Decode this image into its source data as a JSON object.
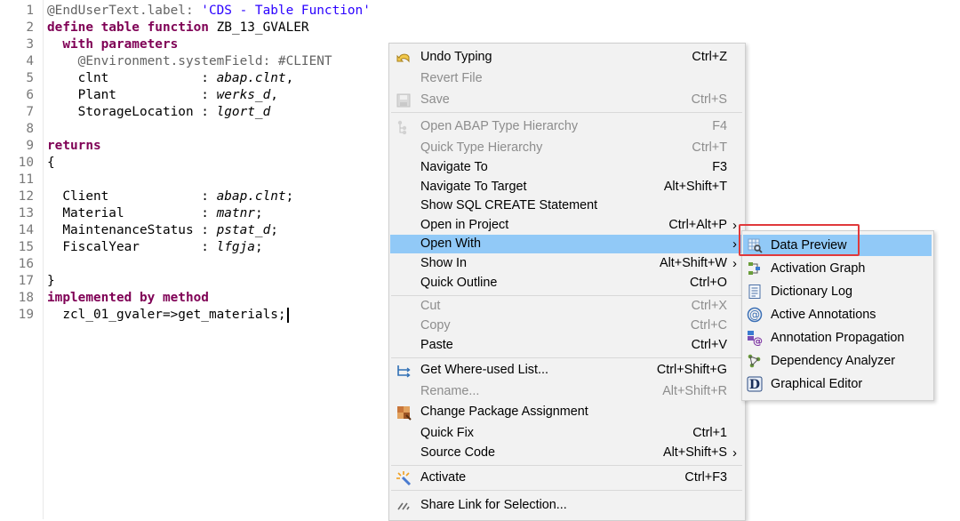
{
  "editor": {
    "lines": [
      {
        "n": "1",
        "parts": [
          {
            "t": "@EndUserText.label: ",
            "c": "ann"
          },
          {
            "t": "'CDS - Table Function'",
            "c": "str"
          }
        ]
      },
      {
        "n": "2",
        "parts": [
          {
            "t": "define table function",
            "c": "kw"
          },
          {
            "t": " ZB_13_GVALER",
            "c": "plain"
          }
        ]
      },
      {
        "n": "3",
        "parts": [
          {
            "t": "  with parameters",
            "c": "kw"
          }
        ]
      },
      {
        "n": "4",
        "parts": [
          {
            "t": "    @Environment.systemField: #CLIENT",
            "c": "ann"
          }
        ]
      },
      {
        "n": "5",
        "parts": [
          {
            "t": "    clnt            : ",
            "c": "plain"
          },
          {
            "t": "abap.clnt",
            "c": "typ"
          },
          {
            "t": ",",
            "c": "plain"
          }
        ]
      },
      {
        "n": "6",
        "parts": [
          {
            "t": "    Plant           : ",
            "c": "plain"
          },
          {
            "t": "werks_d",
            "c": "typ"
          },
          {
            "t": ",",
            "c": "plain"
          }
        ]
      },
      {
        "n": "7",
        "parts": [
          {
            "t": "    StorageLocation : ",
            "c": "plain"
          },
          {
            "t": "lgort_d",
            "c": "typ"
          }
        ]
      },
      {
        "n": "8",
        "parts": []
      },
      {
        "n": "9",
        "parts": [
          {
            "t": "returns",
            "c": "kw"
          }
        ]
      },
      {
        "n": "10",
        "parts": [
          {
            "t": "{",
            "c": "plain"
          }
        ]
      },
      {
        "n": "11",
        "parts": []
      },
      {
        "n": "12",
        "parts": [
          {
            "t": "  Client            : ",
            "c": "plain"
          },
          {
            "t": "abap.clnt",
            "c": "typ"
          },
          {
            "t": ";",
            "c": "plain"
          }
        ]
      },
      {
        "n": "13",
        "parts": [
          {
            "t": "  Material          : ",
            "c": "plain"
          },
          {
            "t": "matnr",
            "c": "typ"
          },
          {
            "t": ";",
            "c": "plain"
          }
        ]
      },
      {
        "n": "14",
        "parts": [
          {
            "t": "  MaintenanceStatus : ",
            "c": "plain"
          },
          {
            "t": "pstat_d",
            "c": "typ"
          },
          {
            "t": ";",
            "c": "plain"
          }
        ]
      },
      {
        "n": "15",
        "parts": [
          {
            "t": "  FiscalYear        : ",
            "c": "plain"
          },
          {
            "t": "lfgja",
            "c": "typ"
          },
          {
            "t": ";",
            "c": "plain"
          }
        ]
      },
      {
        "n": "16",
        "parts": []
      },
      {
        "n": "17",
        "parts": [
          {
            "t": "}",
            "c": "plain"
          }
        ]
      },
      {
        "n": "18",
        "parts": [
          {
            "t": "implemented by method",
            "c": "kw"
          }
        ]
      },
      {
        "n": "19",
        "parts": [
          {
            "t": "  zcl_01_gvaler=>get_materials;",
            "c": "plain"
          }
        ],
        "caret": true
      }
    ]
  },
  "context_menu": {
    "items": [
      {
        "id": "undo-typing",
        "label": "Undo Typing",
        "shortcut": "Ctrl+Z",
        "enabled": true,
        "icon": "undo-icon"
      },
      {
        "id": "revert-file",
        "label": "Revert File",
        "shortcut": "",
        "enabled": false,
        "icon": ""
      },
      {
        "id": "save",
        "label": "Save",
        "shortcut": "Ctrl+S",
        "enabled": false,
        "icon": "save-icon"
      },
      {
        "sep": true
      },
      {
        "id": "open-abap-type-hierarchy",
        "label": "Open ABAP Type Hierarchy",
        "shortcut": "F4",
        "enabled": false,
        "icon": "hierarchy-icon"
      },
      {
        "id": "quick-type-hierarchy",
        "label": "Quick Type Hierarchy",
        "shortcut": "Ctrl+T",
        "enabled": false,
        "icon": ""
      },
      {
        "id": "navigate-to",
        "label": "Navigate To",
        "shortcut": "F3",
        "enabled": true,
        "icon": ""
      },
      {
        "id": "navigate-to-target",
        "label": "Navigate To Target",
        "shortcut": "Alt+Shift+T",
        "enabled": true,
        "icon": ""
      },
      {
        "id": "show-sql-create-statement",
        "label": "Show SQL CREATE Statement",
        "shortcut": "",
        "enabled": true,
        "icon": ""
      },
      {
        "id": "open-in-project",
        "label": "Open in Project",
        "shortcut": "Ctrl+Alt+P",
        "enabled": true,
        "icon": "",
        "submenu": true
      },
      {
        "id": "open-with",
        "label": "Open With",
        "shortcut": "",
        "enabled": true,
        "icon": "",
        "submenu": true,
        "highlight": true
      },
      {
        "id": "show-in",
        "label": "Show In",
        "shortcut": "Alt+Shift+W",
        "enabled": true,
        "icon": "",
        "submenu": true
      },
      {
        "id": "quick-outline",
        "label": "Quick Outline",
        "shortcut": "Ctrl+O",
        "enabled": true,
        "icon": ""
      },
      {
        "sep": true
      },
      {
        "id": "cut",
        "label": "Cut",
        "shortcut": "Ctrl+X",
        "enabled": false,
        "icon": ""
      },
      {
        "id": "copy",
        "label": "Copy",
        "shortcut": "Ctrl+C",
        "enabled": false,
        "icon": ""
      },
      {
        "id": "paste",
        "label": "Paste",
        "shortcut": "Ctrl+V",
        "enabled": true,
        "icon": ""
      },
      {
        "sep": true
      },
      {
        "id": "get-where-used-list",
        "label": "Get Where-used List...",
        "shortcut": "Ctrl+Shift+G",
        "enabled": true,
        "icon": "where-used-icon"
      },
      {
        "id": "rename",
        "label": "Rename...",
        "shortcut": "Alt+Shift+R",
        "enabled": false,
        "icon": ""
      },
      {
        "id": "change-package-assignment",
        "label": "Change Package Assignment",
        "shortcut": "",
        "enabled": true,
        "icon": "package-icon"
      },
      {
        "id": "quick-fix",
        "label": "Quick Fix",
        "shortcut": "Ctrl+1",
        "enabled": true,
        "icon": ""
      },
      {
        "id": "source-code",
        "label": "Source Code",
        "shortcut": "Alt+Shift+S",
        "enabled": true,
        "icon": "",
        "submenu": true
      },
      {
        "sep": true
      },
      {
        "id": "activate",
        "label": "Activate",
        "shortcut": "Ctrl+F3",
        "enabled": true,
        "icon": "activate-icon"
      },
      {
        "sep": true
      },
      {
        "id": "share-link-for-selection",
        "label": "Share Link for Selection...",
        "shortcut": "",
        "enabled": true,
        "icon": "share-link-icon"
      }
    ]
  },
  "submenu": {
    "items": [
      {
        "id": "data-preview",
        "label": "Data Preview",
        "icon": "data-preview-icon",
        "highlight": true
      },
      {
        "id": "activation-graph",
        "label": "Activation Graph",
        "icon": "activation-graph-icon"
      },
      {
        "id": "dictionary-log",
        "label": "Dictionary Log",
        "icon": "dictionary-log-icon"
      },
      {
        "id": "active-annotations",
        "label": "Active Annotations",
        "icon": "at-sign-icon"
      },
      {
        "id": "annotation-propagation",
        "label": "Annotation Propagation",
        "icon": "annotation-propagation-icon"
      },
      {
        "id": "dependency-analyzer",
        "label": "Dependency Analyzer",
        "icon": "dependency-analyzer-icon"
      },
      {
        "id": "graphical-editor",
        "label": "Graphical Editor",
        "icon": "graphical-editor-icon"
      }
    ]
  },
  "colors": {
    "highlight": "#91c9f7",
    "callout": "#e0393b",
    "keyword": "#7f0055",
    "string": "#2a00ff"
  }
}
